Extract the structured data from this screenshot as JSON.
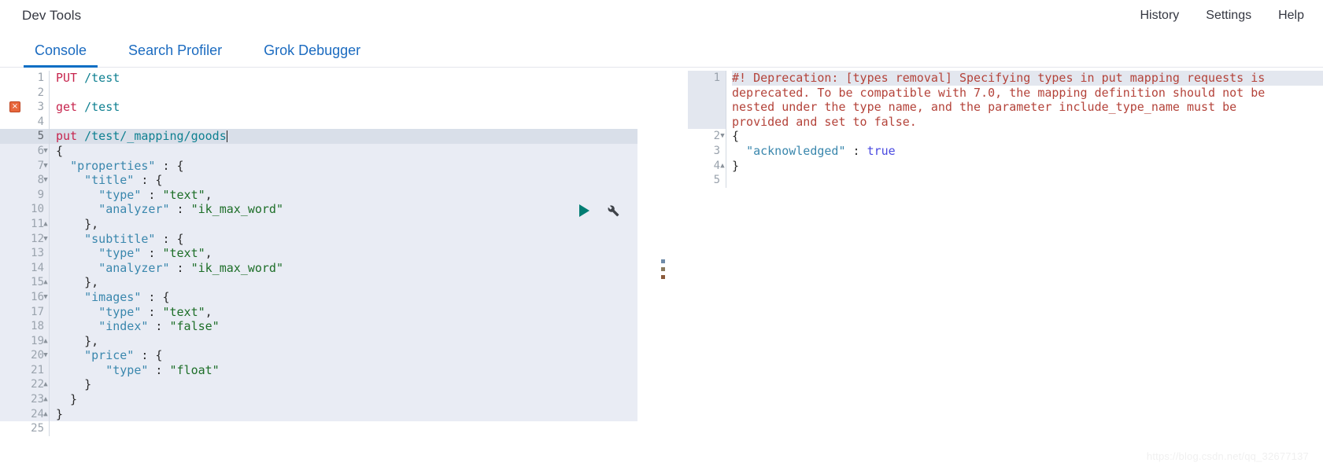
{
  "header": {
    "app_title": "Dev Tools",
    "links": [
      {
        "label": "History"
      },
      {
        "label": "Settings"
      },
      {
        "label": "Help"
      }
    ]
  },
  "tabs": [
    {
      "label": "Console",
      "active": true
    },
    {
      "label": "Search Profiler",
      "active": false
    },
    {
      "label": "Grok Debugger",
      "active": false
    }
  ],
  "editor": {
    "actions": {
      "play_label": "play-icon",
      "wrench_label": "wrench-icon"
    },
    "error_marker": "×",
    "lines": [
      {
        "n": "1",
        "text": "PUT /test"
      },
      {
        "n": "2",
        "text": ""
      },
      {
        "n": "3",
        "text": "get /test"
      },
      {
        "n": "4",
        "text": ""
      },
      {
        "n": "5",
        "text": "put /test/_mapping/goods"
      },
      {
        "n": "6",
        "text": "{"
      },
      {
        "n": "7",
        "text": "  \"properties\" : {"
      },
      {
        "n": "8",
        "text": "    \"title\" : {"
      },
      {
        "n": "9",
        "text": "      \"type\" : \"text\","
      },
      {
        "n": "10",
        "text": "      \"analyzer\" : \"ik_max_word\""
      },
      {
        "n": "11",
        "text": "    },"
      },
      {
        "n": "12",
        "text": "    \"subtitle\" : {"
      },
      {
        "n": "13",
        "text": "      \"type\" : \"text\","
      },
      {
        "n": "14",
        "text": "      \"analyzer\" : \"ik_max_word\""
      },
      {
        "n": "15",
        "text": "    },"
      },
      {
        "n": "16",
        "text": "    \"images\" : {"
      },
      {
        "n": "17",
        "text": "      \"type\" : \"text\","
      },
      {
        "n": "18",
        "text": "      \"index\" : \"false\""
      },
      {
        "n": "19",
        "text": "    },"
      },
      {
        "n": "20",
        "text": "    \"price\" : {"
      },
      {
        "n": "21",
        "text": "       \"type\" : \"float\""
      },
      {
        "n": "22",
        "text": "    }"
      },
      {
        "n": "23",
        "text": "  }"
      },
      {
        "n": "24",
        "text": "}"
      },
      {
        "n": "25",
        "text": ""
      }
    ]
  },
  "response": {
    "warning_line_number": "1",
    "warning_text": "#! Deprecation: [types removal] Specifying types in put mapping requests is\ndeprecated. To be compatible with 7.0, the mapping definition should not be\nnested under the type name, and the parameter include_type_name must be\nprovided and set to false.",
    "warning_lines": [
      "#! Deprecation: [types removal] Specifying types in put mapping requests is",
      "deprecated. To be compatible with 7.0, the mapping definition should not be",
      "nested under the type name, and the parameter include_type_name must be",
      "provided and set to false."
    ],
    "lines": [
      {
        "n": "2",
        "open_brace": "{"
      },
      {
        "n": "3",
        "key": "\"acknowledged\"",
        "sep": " : ",
        "value": "true"
      },
      {
        "n": "4",
        "close_brace": "}"
      },
      {
        "n": "5",
        "text": ""
      }
    ]
  },
  "watermark": "https://blog.csdn.net/qq_32677137",
  "colors": {
    "accent_blue": "#0b6ec4",
    "link_blue": "#1b6bc0",
    "method_pink": "#c7254e",
    "url_teal": "#0f8091",
    "key_blue": "#3a87ad",
    "string_green": "#1d6e28",
    "bool_purple": "#4a4ae0",
    "warning_red": "#b4433a",
    "play_teal": "#017d73",
    "error_orange": "#e8673c"
  }
}
